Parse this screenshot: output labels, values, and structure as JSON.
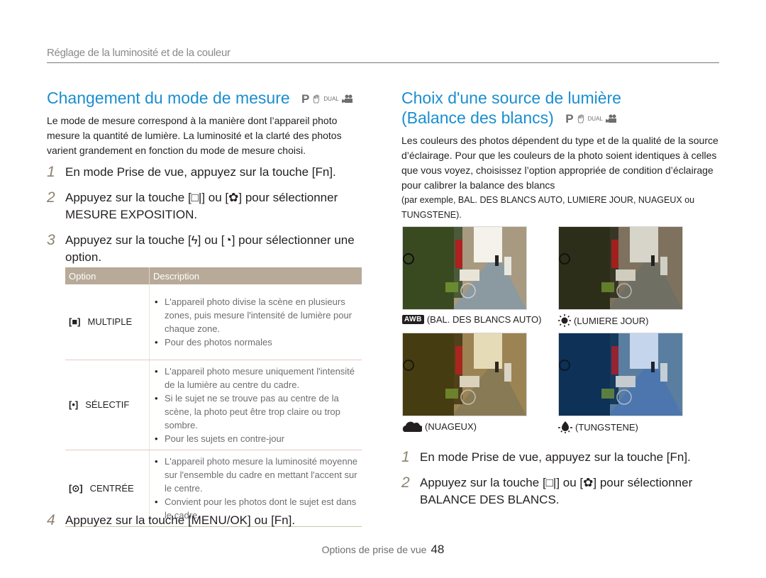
{
  "header": {
    "section_title": "Réglage de la luminosité et de la couleur"
  },
  "left": {
    "title": "Changement du mode de mesure",
    "mode_icons": {
      "p": "P",
      "dual": "DUAL"
    },
    "intro": "Le mode de mesure correspond à la manière dont l’appareil photo mesure la quantité de lumière. La luminosité et la clarté des photos varient grandement en fonction du mode de mesure choisi.",
    "steps": [
      {
        "num": "1",
        "text": "En mode Prise de vue, appuyez sur la touche [Fn]."
      },
      {
        "num": "2",
        "text": "Appuyez sur la touche [□|] ou [✿] pour sélectionner MESURE EXPOSITION."
      },
      {
        "num": "3",
        "text": "Appuyez sur la touche [ϟ] ou [◔] pour sélectionner une option."
      },
      {
        "num": "4",
        "text": "Appuyez sur la touche [MENU/OK] ou [Fn]."
      }
    ],
    "table": {
      "headers": [
        "Option",
        "Description"
      ],
      "rows": [
        {
          "icon": "[■]",
          "icon_name": "multi-metering-icon",
          "option": "MULTIPLE",
          "bullets": [
            "L'appareil photo divise la scène en plusieurs zones, puis mesure l'intensité de lumière pour chaque zone.",
            "Pour des photos normales"
          ]
        },
        {
          "icon": "[•]",
          "icon_name": "spot-metering-icon",
          "option": "SÉLECTIF",
          "bullets": [
            "L'appareil photo mesure uniquement l'intensité de la lumière au centre du cadre.",
            "Si le sujet ne se trouve pas au centre de la scène, la photo peut être trop claire ou trop sombre.",
            "Pour les sujets en contre-jour"
          ]
        },
        {
          "icon": "[⊙]",
          "icon_name": "center-weighted-icon",
          "option": "CENTRÉE",
          "bullets": [
            "L'appareil photo mesure la luminosité moyenne sur l'ensemble du cadre en mettant l'accent sur le centre.",
            "Convient pour les photos dont le sujet est dans le cadre."
          ]
        }
      ]
    }
  },
  "right": {
    "title_line1": "Choix d'une source de lumière",
    "title_line2": "(Balance des blancs)",
    "mode_icons": {
      "p": "P",
      "dual": "DUAL"
    },
    "intro": "Les couleurs des photos dépendent du type et de la qualité de la source d’éclairage. Pour que les couleurs de la photo soient identiques à celles que vous voyez, choisissez l’option appropriée de condition d’éclairage pour calibrer la balance des blancs",
    "intro_examples": "(par exemple, BAL. DES BLANCS AUTO, LUMIERE JOUR, NUAGEUX ou TUNGSTENE).",
    "photos": [
      {
        "icon": "AWB",
        "icon_name": "awb-icon",
        "caption": "(BAL. DES BLANCS AUTO)",
        "tint": "auto"
      },
      {
        "icon": "☀",
        "icon_name": "sun-icon",
        "caption": "(LUMIERE JOUR)",
        "tint": "daylight"
      },
      {
        "icon": "☁",
        "icon_name": "cloud-icon",
        "caption": "(NUAGEUX)",
        "tint": "cloudy"
      },
      {
        "icon": "💡",
        "icon_name": "tungsten-bulb-icon",
        "caption": "(TUNGSTENE)",
        "tint": "tungsten"
      }
    ],
    "steps": [
      {
        "num": "1",
        "text": "En mode Prise de vue, appuyez sur la touche [Fn]."
      },
      {
        "num": "2",
        "text": "Appuyez sur la touche [□|] ou [✿] pour sélectionner BALANCE DES BLANCS."
      }
    ]
  },
  "footer": {
    "label": "Options de prise de vue",
    "page": "48"
  },
  "colors": {
    "title_blue": "#1a8ed0",
    "table_header": "#b8aa98",
    "step_num": "#8c8270"
  }
}
